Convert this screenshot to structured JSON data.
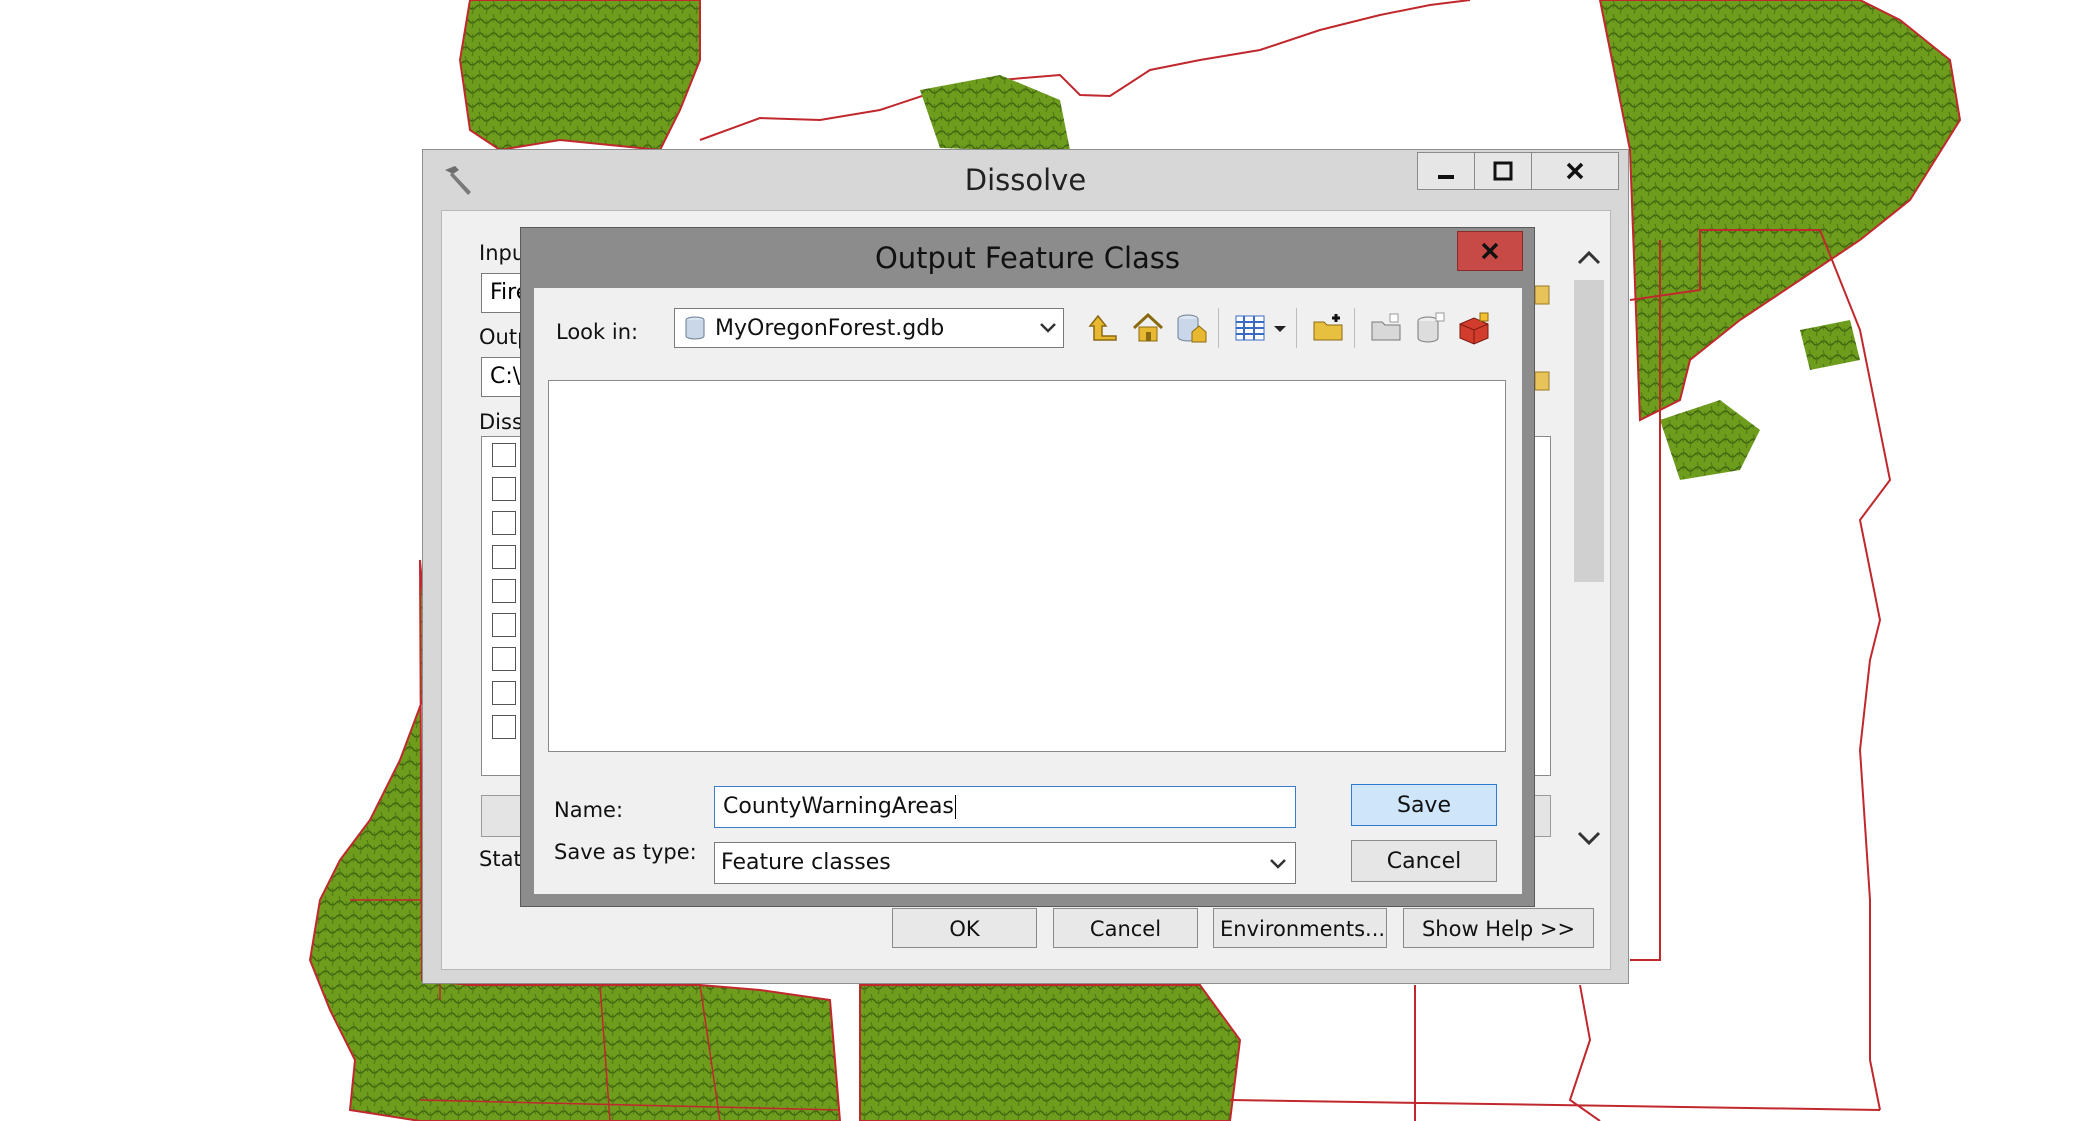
{
  "dissolve_window": {
    "title": "Dissolve",
    "params": {
      "input_label": "Input Features",
      "input_value": "FireZones",
      "output_label": "Output Feature Class",
      "output_value": "C:\\",
      "dissolve_label": "Dissolve_Field(s)",
      "stats_label": "Statistics Field(s)"
    },
    "buttons": {
      "ok": "OK",
      "cancel": "Cancel",
      "environments": "Environments...",
      "show_help": "Show Help >>"
    }
  },
  "output_dialog": {
    "title": "Output Feature Class",
    "look_in_label": "Look in:",
    "look_in_value": "MyOregonForest.gdb",
    "name_label": "Name:",
    "name_value": "CountyWarningAreas",
    "save_as_type_label": "Save as type:",
    "save_as_type_value": "Feature classes",
    "save_button": "Save",
    "cancel_button": "Cancel",
    "toolbar_icons": [
      "up-one-level-icon",
      "home-icon",
      "default-geodatabase-icon",
      "view-details-icon",
      "view-dropdown-icon",
      "connect-folder-icon",
      "new-folder-icon",
      "new-geodatabase-icon",
      "new-toolbox-icon"
    ]
  },
  "colors": {
    "forest": "#6b9a1c",
    "boundary": "#c0282d",
    "close_button": "#c74a47",
    "save_highlight": "#cfe5fa"
  }
}
